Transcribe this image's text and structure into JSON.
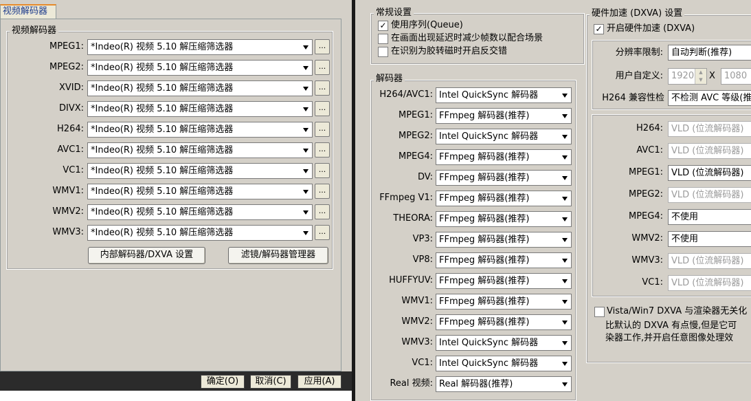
{
  "left": {
    "tab_label": "视频解码器",
    "group_title": "视频解码器",
    "rows": [
      {
        "label": "MPEG1:",
        "value": "*Indeo(R) 视频 5.10 解压缩筛选器"
      },
      {
        "label": "MPEG2:",
        "value": "*Indeo(R) 视频 5.10 解压缩筛选器"
      },
      {
        "label": "XVID:",
        "value": "*Indeo(R) 视频 5.10 解压缩筛选器"
      },
      {
        "label": "DIVX:",
        "value": "*Indeo(R) 视频 5.10 解压缩筛选器"
      },
      {
        "label": "H264:",
        "value": "*Indeo(R) 视频 5.10 解压缩筛选器"
      },
      {
        "label": "AVC1:",
        "value": "*Indeo(R) 视频 5.10 解压缩筛选器"
      },
      {
        "label": "VC1:",
        "value": "*Indeo(R) 视频 5.10 解压缩筛选器"
      },
      {
        "label": "WMV1:",
        "value": "*Indeo(R) 视频 5.10 解压缩筛选器"
      },
      {
        "label": "WMV2:",
        "value": "*Indeo(R) 视频 5.10 解压缩筛选器"
      },
      {
        "label": "WMV3:",
        "value": "*Indeo(R) 视频 5.10 解压缩筛选器"
      }
    ],
    "dots_label": "...",
    "btn_internal": "内部解码器/DXVA 设置",
    "btn_filters": "滤镜/解码器管理器",
    "ok": "确定(O)",
    "cancel": "取消(C)",
    "apply": "应用(A)"
  },
  "general": {
    "title": "常规设置",
    "items": [
      {
        "label": "使用序列(Queue)",
        "checked": true
      },
      {
        "label": "在画面出现延迟时减少帧数以配合场景",
        "checked": false
      },
      {
        "label": "在识别为胶转磁时开启反交错",
        "checked": false
      }
    ]
  },
  "decoders": {
    "title": "解码器",
    "rows": [
      {
        "label": "H264/AVC1:",
        "value": "Intel QuickSync 解码器"
      },
      {
        "label": "MPEG1:",
        "value": "FFmpeg 解码器(推荐)"
      },
      {
        "label": "MPEG2:",
        "value": "Intel QuickSync 解码器"
      },
      {
        "label": "MPEG4:",
        "value": "FFmpeg 解码器(推荐)"
      },
      {
        "label": "DV:",
        "value": "FFmpeg 解码器(推荐)"
      },
      {
        "label": "FFmpeg V1:",
        "value": "FFmpeg 解码器(推荐)"
      },
      {
        "label": "THEORA:",
        "value": "FFmpeg 解码器(推荐)"
      },
      {
        "label": "VP3:",
        "value": "FFmpeg 解码器(推荐)"
      },
      {
        "label": "VP8:",
        "value": "FFmpeg 解码器(推荐)"
      },
      {
        "label": "HUFFYUV:",
        "value": "FFmpeg 解码器(推荐)"
      },
      {
        "label": "WMV1:",
        "value": "FFmpeg 解码器(推荐)"
      },
      {
        "label": "WMV2:",
        "value": "FFmpeg 解码器(推荐)"
      },
      {
        "label": "WMV3:",
        "value": "Intel QuickSync 解码器"
      },
      {
        "label": "VC1:",
        "value": "Intel QuickSync 解码器"
      },
      {
        "label": "Real 视频:",
        "value": "Real 解码器(推荐)"
      }
    ]
  },
  "dxva": {
    "title": "硬件加速 (DXVA) 设置",
    "enable_label": "开启硬件加速 (DXVA)",
    "enable_checked": true,
    "res_label": "分辨率限制:",
    "res_value": "自动判断(推荐)",
    "custom_label": "用户自定义:",
    "width_value": "1920",
    "x_label": "X",
    "height_value": "1080",
    "h264_compat_label": "H264 兼容性检",
    "h264_compat_value": "不检测 AVC 等级(推",
    "codecs": [
      {
        "label": "H264:",
        "value": "VLD (位流解码器)",
        "enabled": false
      },
      {
        "label": "AVC1:",
        "value": "VLD (位流解码器)",
        "enabled": false
      },
      {
        "label": "MPEG1:",
        "value": "VLD (位流解码器)",
        "enabled": true
      },
      {
        "label": "MPEG2:",
        "value": "VLD (位流解码器)",
        "enabled": false
      },
      {
        "label": "MPEG4:",
        "value": "不使用",
        "enabled": true
      },
      {
        "label": "WMV2:",
        "value": "不使用",
        "enabled": true
      },
      {
        "label": "WMV3:",
        "value": "VLD (位流解码器)",
        "enabled": false
      },
      {
        "label": "VC1:",
        "value": "VLD (位流解码器)",
        "enabled": false
      }
    ],
    "vista_label": "Vista/Win7 DXVA 与渲染器无关化",
    "vista_desc1": "比默认的 DXVA 有点慢,但是它可",
    "vista_desc2": "染器工作,并开启任意图像处理效"
  },
  "colors": {
    "panel": "#d4d0c8",
    "tab_accent": "#e68b2c",
    "tab_text": "#1e3c8c",
    "bottom_bar": "#2b2b2b"
  }
}
